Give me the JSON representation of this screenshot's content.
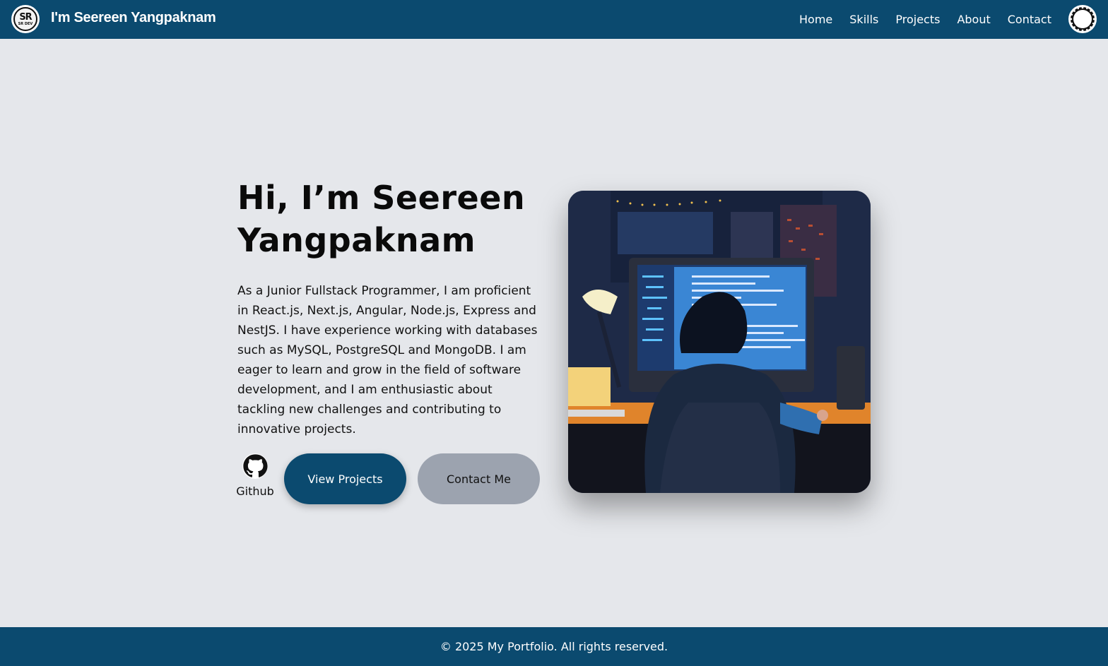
{
  "header": {
    "logo_text": "SR",
    "logo_subtext": "SR DEV",
    "brand": "I'm Seereen Yangpaknam",
    "nav": [
      {
        "label": "Home"
      },
      {
        "label": "Skills"
      },
      {
        "label": "Projects"
      },
      {
        "label": "About"
      },
      {
        "label": "Contact"
      }
    ],
    "theme_toggle_icon": "sun-icon"
  },
  "hero": {
    "title": "Hi, I’m Seereen Yangpaknam",
    "description": "As a Junior Fullstack Programmer, I am proficient in React.js, Next.js, Angular, Node.js, Express and NestJS. I have experience working with databases such as MySQL, PostgreSQL and MongoDB. I am eager to learn and grow in the field of software development, and I am enthusiastic about tackling new challenges and contributing to innovative projects.",
    "github_label": "Github",
    "github_icon": "github-icon",
    "view_projects_label": "View Projects",
    "contact_label": "Contact Me",
    "image_icon": "programmer-illustration"
  },
  "footer": {
    "text": "© 2025 My Portfolio. All rights reserved."
  },
  "colors": {
    "primary": "#0b4a6f",
    "background": "#e5e7eb",
    "secondary_button": "#9ca3af"
  }
}
